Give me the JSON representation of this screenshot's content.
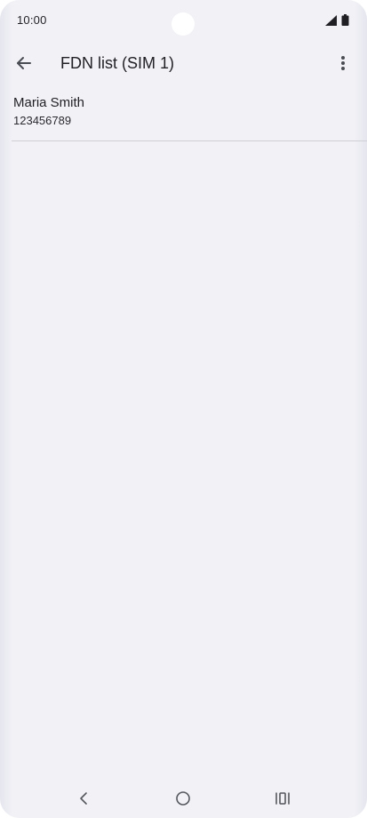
{
  "status_bar": {
    "time": "10:00",
    "icons": [
      "signal-icon",
      "battery-icon"
    ]
  },
  "app_bar": {
    "title": "FDN list (SIM 1)",
    "back_icon": "arrow-left-icon",
    "menu_icon": "more-vertical-icon"
  },
  "contacts": [
    {
      "name": "Maria Smith",
      "number": "123456789"
    }
  ],
  "nav_bar": {
    "icons": [
      "nav-back-icon",
      "nav-home-icon",
      "nav-recents-icon"
    ]
  },
  "colors": {
    "background": "#f1f1f6",
    "text": "#1f1f24",
    "icon": "#55575e",
    "divider": "#cfd0d6"
  }
}
